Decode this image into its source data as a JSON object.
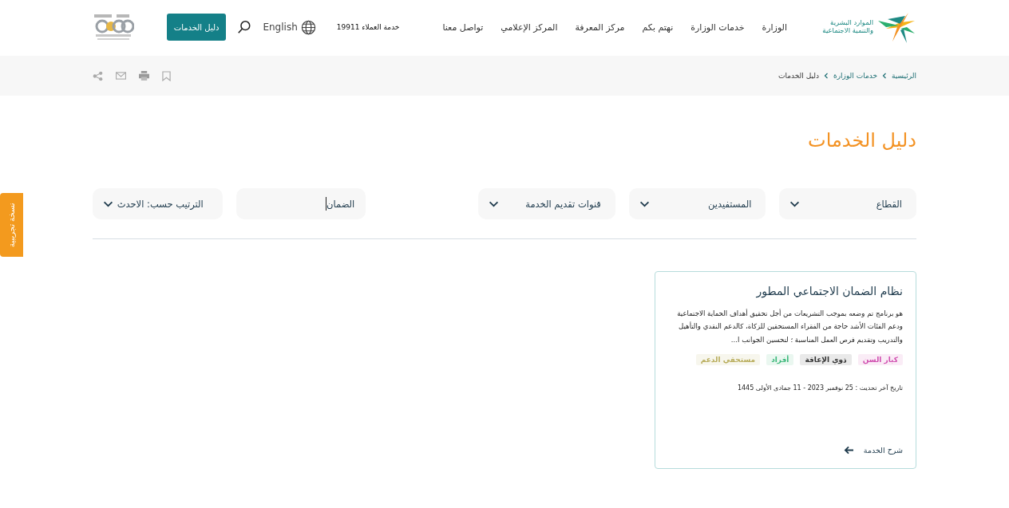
{
  "header": {
    "logo_text": "الموارد البشرية والتنمية الاجتماعية",
    "nav": [
      "الوزارة",
      "خدمات الوزارة",
      "نهتم بكم",
      "مركز المعرفة",
      "المركز الإعلامي",
      "تواصل معنا"
    ],
    "customer_service": "خدمة العملاء 19911",
    "language": "English",
    "guide_button": "دليل الخدمات"
  },
  "breadcrumb": [
    "الرئيسية",
    "خدمات الوزارة",
    "دليل الخدمات"
  ],
  "beta_tab": "نسخة تجريبية",
  "page_title": "دليل الخدمات",
  "filters": [
    {
      "kind": "select",
      "label": "القطاع"
    },
    {
      "kind": "select",
      "label": "المستفيدين"
    },
    {
      "kind": "select",
      "label": "قنوات تقديم الخدمة"
    },
    {
      "kind": "search",
      "value": "الضمان"
    },
    {
      "kind": "select",
      "label": "الترتيب حسب: الاحدث"
    }
  ],
  "cards": [
    {
      "title": "نظام الضمان الاجتماعي المطور",
      "description": "هو برنامج تم وضعه بموجب التشريعات من أجل تحقيق أهداف الحماية الاجتماعية ودعم الفئات الأشد حاجة من الفقراء المستحقين للزكاة، كالدعم النقدي والتأهيل والتدريب وتقديم فرص العمل المناسبة ؛ لتحسين الجوانب ا...",
      "tags": [
        {
          "label": "كبار السن",
          "color": "#d04fb0"
        },
        {
          "label": "ذوي الإعاقة",
          "color": "#333333"
        },
        {
          "label": "أفراد",
          "color": "#3cb87a"
        },
        {
          "label": "مستحقي الدعم",
          "color": "#b8ac5a"
        }
      ],
      "updated": "تاريخ آخر تحديث : 25 نوفمبر 2023 - 11 جمادى الأولى 1445",
      "link": "شرح الخدمة"
    }
  ]
}
